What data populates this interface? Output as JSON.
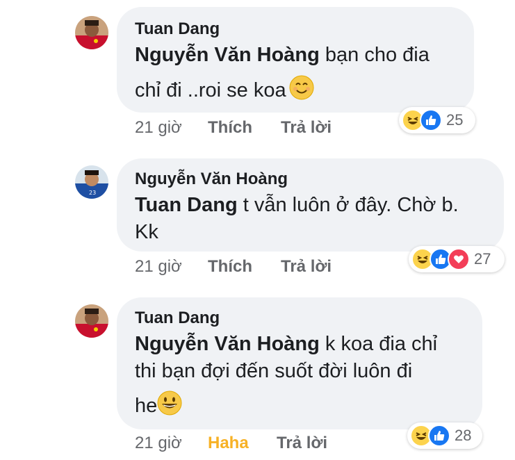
{
  "colors": {
    "bubble": "#f0f2f5",
    "like": "#1877f2",
    "love": "#f33e58",
    "haha": "#f7b125",
    "muted": "#65676b"
  },
  "comments": [
    {
      "author": "Tuan Dang",
      "mention": "Nguyễn Văn Hoàng",
      "line1": " bạn cho đia",
      "line2": "chỉ đi ..roi se koa",
      "line2_emoji": "smiling-face-emoji",
      "time": "21 giờ",
      "action1": "Thích",
      "action2": "Trả lời",
      "reactions": [
        "haha",
        "like"
      ],
      "count": "25"
    },
    {
      "author": "Nguyễn Văn Hoàng",
      "mention": "Tuan Dang",
      "line1": " t vẫn luôn ở đây. Chờ b.",
      "line2": "Kk",
      "time": "21 giờ",
      "action1": "Thích",
      "action2": "Trả lời",
      "reactions": [
        "haha",
        "like",
        "love"
      ],
      "count": "27"
    },
    {
      "author": "Tuan Dang",
      "mention": "Nguyễn Văn Hoàng",
      "line1": " k koa đia chỉ",
      "line2": "thi bạn đợi đến suốt đời luôn đi",
      "line3": "he",
      "line3_emoji": "grinning-face-emoji",
      "time": "21 giờ",
      "action1": "Haha",
      "action2": "Trả lời",
      "reactions": [
        "haha",
        "like"
      ],
      "count": "28"
    }
  ]
}
